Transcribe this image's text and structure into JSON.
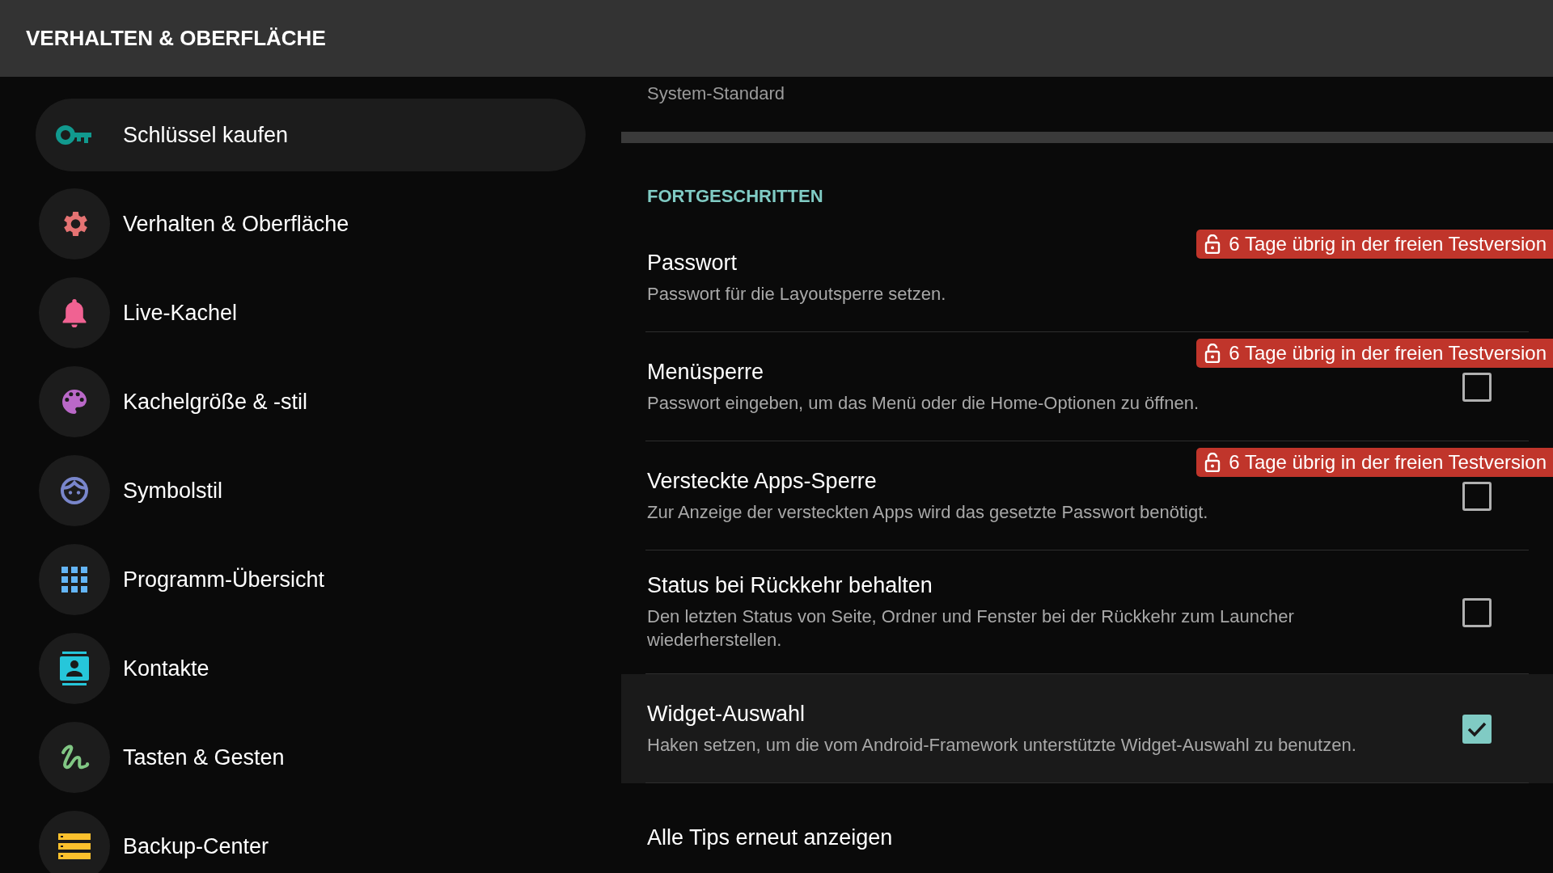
{
  "header": {
    "title": "VERHALTEN & OBERFLÄCHE"
  },
  "sidebar": {
    "items": [
      {
        "label": "Schlüssel kaufen",
        "selected": true
      },
      {
        "label": "Verhalten & Oberfläche",
        "selected": false
      },
      {
        "label": "Live-Kachel",
        "selected": false
      },
      {
        "label": "Kachelgröße & -stil",
        "selected": false
      },
      {
        "label": "Symbolstil",
        "selected": false
      },
      {
        "label": "Programm-Übersicht",
        "selected": false
      },
      {
        "label": "Kontakte",
        "selected": false
      },
      {
        "label": "Tasten & Gesten",
        "selected": false
      },
      {
        "label": "Backup-Center",
        "selected": false
      }
    ]
  },
  "settings": {
    "previous_value": "System-Standard",
    "section_title": "FORTGESCHRITTEN",
    "rows": [
      {
        "kind": "text",
        "title": "Passwort",
        "summary": "Passwort für die Layoutsperre setzen.",
        "badge": "6 Tage übrig in der freien Testversion",
        "selected": false
      },
      {
        "kind": "checkbox",
        "title": "Menüsperre",
        "summary": "Passwort eingeben, um das Menü oder die Home-Optionen zu öffnen.",
        "badge": "6 Tage übrig in der freien Testversion",
        "checked": false,
        "selected": false
      },
      {
        "kind": "checkbox",
        "title": "Versteckte Apps-Sperre",
        "summary": "Zur Anzeige der versteckten Apps wird das gesetzte Passwort benötigt.",
        "badge": "6 Tage übrig in der freien Testversion",
        "checked": false,
        "selected": false
      },
      {
        "kind": "checkbox",
        "title": "Status bei Rückkehr behalten",
        "summary": "Den letzten Status von Seite, Ordner und Fenster bei der Rückkehr zum Launcher wiederherstellen.",
        "checked": false,
        "selected": false
      },
      {
        "kind": "checkbox",
        "title": "Widget-Auswahl",
        "summary": "Haken setzen, um die vom Android-Framework unterstützte Widget-Auswahl zu benutzen.",
        "checked": true,
        "selected": true
      },
      {
        "kind": "text",
        "title": "Alle Tips erneut anzeigen",
        "selected": false
      }
    ]
  }
}
